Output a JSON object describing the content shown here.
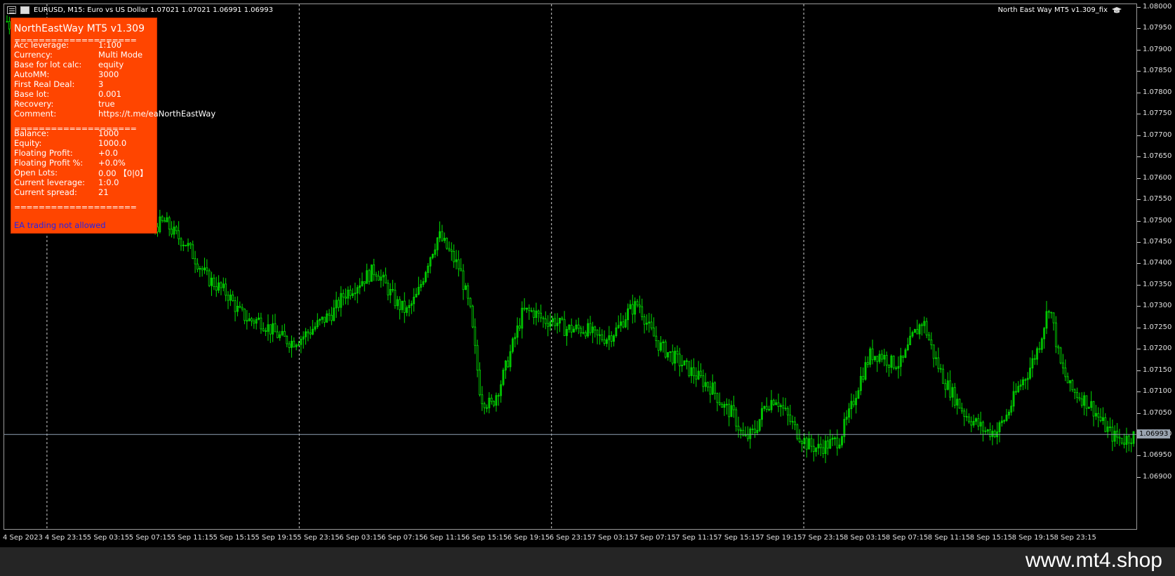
{
  "symbol_bar": {
    "grid_icon": "grid-icon",
    "candle_icon": "candlestick-icon",
    "text": "EURUSD, M15:  Euro vs US Dollar  1.07021 1.07021 1.06991 1.06993"
  },
  "ea_label": {
    "text": "North East Way MT5 v1.309_fix",
    "icon": "graduation-cap-icon"
  },
  "info_panel": {
    "title": "NorthEastWay MT5 v1.309",
    "separator": "====================",
    "rows_top": [
      {
        "label": "Acc leverage:",
        "value": "1:100"
      },
      {
        "label": "Currency:",
        "value": "Multi Mode"
      },
      {
        "label": "Base for lot calc:",
        "value": "equity"
      },
      {
        "label": "AutoMM:",
        "value": "3000"
      },
      {
        "label": "First Real Deal:",
        "value": "3"
      },
      {
        "label": "Base lot:",
        "value": "0.001"
      },
      {
        "label": "Recovery:",
        "value": "true"
      },
      {
        "label": "Comment:",
        "value": "https://t.me/eaNorthEastWay"
      }
    ],
    "rows_bottom": [
      {
        "label": "Balance:",
        "value": "1000"
      },
      {
        "label": "Equity:",
        "value": "1000.0"
      },
      {
        "label": "Floating Profit:",
        "value": "+0.0"
      },
      {
        "label": "Floating Profit %:",
        "value": "+0.0%"
      },
      {
        "label": "Open Lots:",
        "value": "0.00 【0|0】"
      },
      {
        "label": "Current leverage:",
        "value": "1:0.0"
      },
      {
        "label": "Current spread:",
        "value": "21"
      }
    ],
    "status": "EA trading not allowed"
  },
  "price_scale": [
    "1.08000",
    "1.07950",
    "1.07900",
    "1.07850",
    "1.07800",
    "1.07750",
    "1.07700",
    "1.07650",
    "1.07600",
    "1.07550",
    "1.07500",
    "1.07450",
    "1.07400",
    "1.07350",
    "1.07300",
    "1.07250",
    "1.07200",
    "1.07150",
    "1.07100",
    "1.07050",
    "1.07000",
    "1.06950",
    "1.06900"
  ],
  "current_price": "1.06993",
  "time_scale": [
    "4 Sep 2023",
    "4 Sep 23:15",
    "5 Sep 03:15",
    "5 Sep 07:15",
    "5 Sep 11:15",
    "5 Sep 15:15",
    "5 Sep 19:15",
    "5 Sep 23:15",
    "6 Sep 03:15",
    "6 Sep 07:15",
    "6 Sep 11:15",
    "6 Sep 15:15",
    "6 Sep 19:15",
    "6 Sep 23:15",
    "7 Sep 03:15",
    "7 Sep 07:15",
    "7 Sep 11:15",
    "7 Sep 15:15",
    "7 Sep 19:15",
    "7 Sep 23:15",
    "8 Sep 03:15",
    "8 Sep 07:15",
    "8 Sep 11:15",
    "8 Sep 15:15",
    "8 Sep 19:15",
    "8 Sep 23:15"
  ],
  "day_separators": [
    "4 Sep 23:15",
    "5 Sep 23:15",
    "6 Sep 23:15",
    "7 Sep 23:15"
  ],
  "colors": {
    "candles": "#00e000",
    "panel_bg": "#ff4500",
    "status_text": "#2222ee",
    "price_line": "#8fa0b4"
  },
  "price_series": [
    1.0796,
    1.0792,
    1.079,
    1.0786,
    1.0783,
    1.078,
    1.0776,
    1.0772,
    1.077,
    1.0768,
    1.0764,
    1.076,
    1.0756,
    1.0752,
    1.0748,
    1.0749,
    1.0746,
    1.0744,
    1.074,
    1.0736,
    1.0734,
    1.0732,
    1.0728,
    1.0726,
    1.0726,
    1.0724,
    1.0722,
    1.0721,
    1.0722,
    1.0724,
    1.0726,
    1.0728,
    1.0732,
    1.0734,
    1.0736,
    1.0738,
    1.0734,
    1.073,
    1.0728,
    1.0732,
    1.074,
    1.0746,
    1.0742,
    1.0738,
    1.0728,
    1.0708,
    1.0706,
    1.0712,
    1.072,
    1.0728,
    1.0728,
    1.0726,
    1.0726,
    1.0724,
    1.0724,
    1.0724,
    1.0722,
    1.0722,
    1.0724,
    1.0728,
    1.073,
    1.0724,
    1.072,
    1.0718,
    1.0716,
    1.0714,
    1.0712,
    1.071,
    1.0706,
    1.0704,
    1.0698,
    1.07,
    1.0706,
    1.0708,
    1.0704,
    1.07,
    1.0697,
    1.0696,
    1.0697,
    1.0698,
    1.0704,
    1.0712,
    1.0718,
    1.0718,
    1.0716,
    1.0716,
    1.0722,
    1.0726,
    1.0718,
    1.0712,
    1.0708,
    1.0704,
    1.0702,
    1.07,
    1.07,
    1.0704,
    1.071,
    1.0714,
    1.072,
    1.073,
    1.0716,
    1.071,
    1.0708,
    1.0706,
    1.0702,
    1.0699,
    1.0698,
    1.0699
  ]
}
